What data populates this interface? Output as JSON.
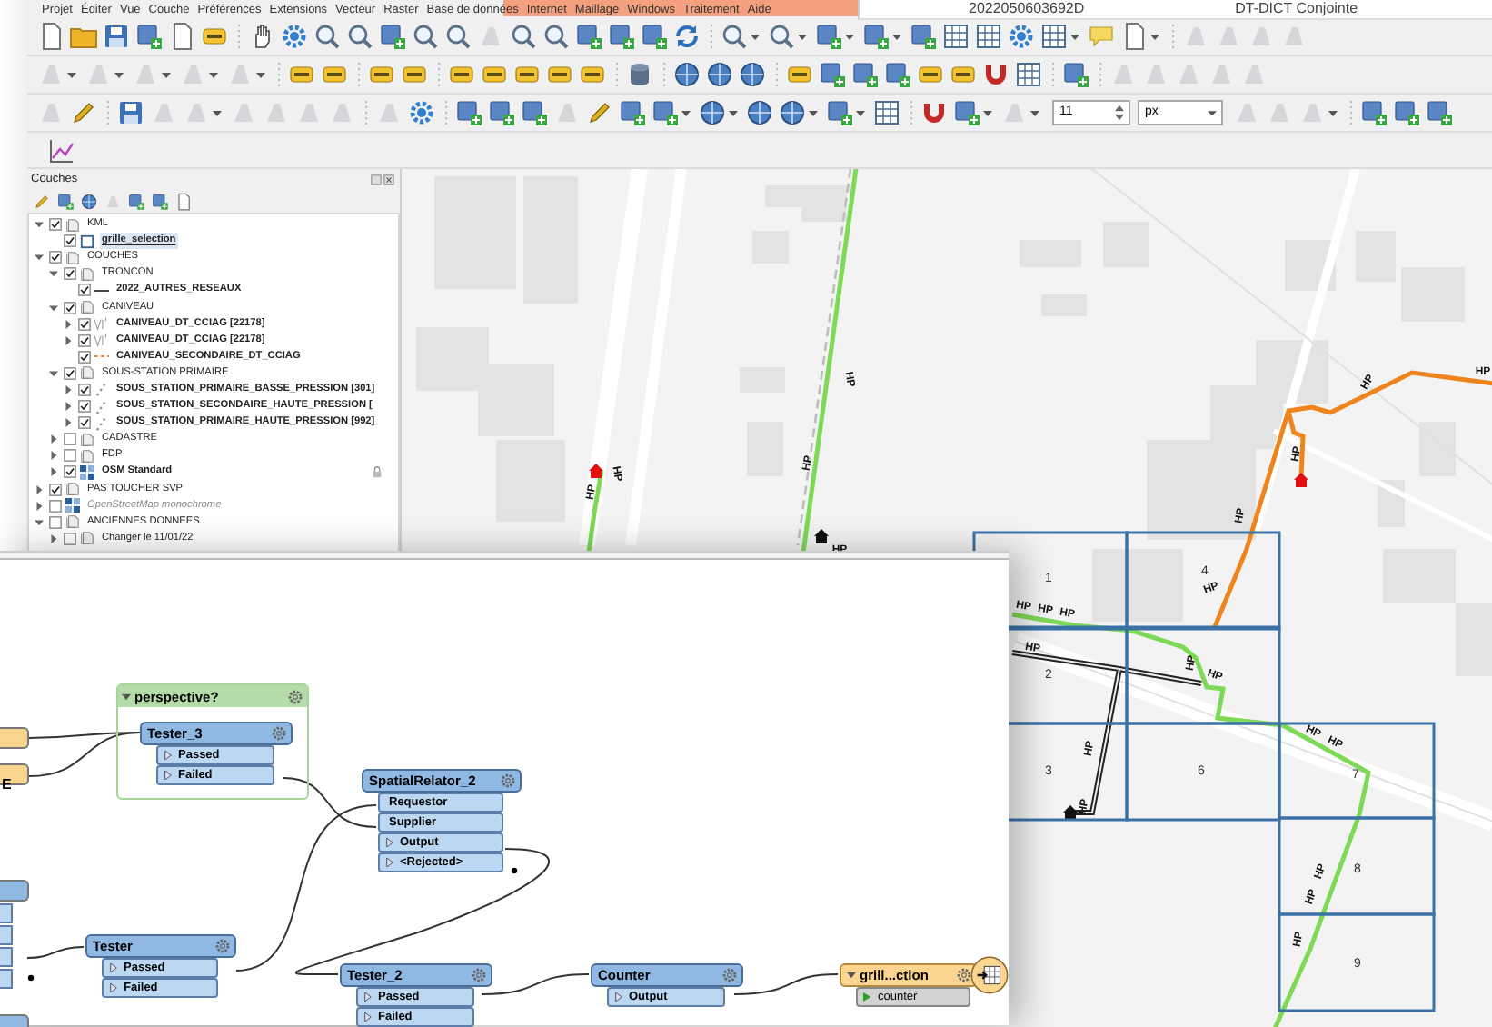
{
  "menu_bar": {
    "items": [
      "Projet",
      "Éditer",
      "Vue",
      "Couche",
      "Préférences",
      "Extensions",
      "Vecteur",
      "Raster",
      "Base de données",
      "Internet",
      "Maillage",
      "Windows",
      "Traitement",
      "Aide"
    ]
  },
  "attribute_table_row": {
    "cells": [
      "2022050603692D",
      "DT-DICT Conjointe"
    ]
  },
  "toolbar": {
    "tolerance": "11",
    "unit": "px"
  },
  "layers_panel": {
    "title": "Couches",
    "tree": [
      {
        "label": "KML",
        "kind": "group",
        "checked": true,
        "selected": false,
        "expanded": true,
        "children": [
          {
            "label": "grille_selection",
            "kind": "polygon",
            "checked": true,
            "selected": true
          }
        ]
      },
      {
        "label": "COUCHES",
        "kind": "group",
        "checked": true,
        "selected": false,
        "expanded": true,
        "children": [
          {
            "label": "TRONCON",
            "kind": "group",
            "checked": true,
            "selected": false,
            "expanded": true,
            "children": [
              {
                "label": "2022_AUTRES_RESEAUX",
                "kind": "line",
                "checked": true,
                "selected": false
              }
            ]
          },
          {
            "label": "CANIVEAU",
            "kind": "group",
            "checked": true,
            "selected": false,
            "expanded": true,
            "children": [
              {
                "label": "CANIVEAU_DT_CCIAG [22178]",
                "kind": "category",
                "checked": true,
                "selected": false,
                "expanded": false
              },
              {
                "label": "CANIVEAU_DT_CCIAG [22178]",
                "kind": "category",
                "checked": true,
                "selected": false,
                "expanded": false
              },
              {
                "label": "CANIVEAU_SECONDAIRE_DT_CCIAG",
                "kind": "dashed",
                "checked": true,
                "selected": false
              }
            ]
          },
          {
            "label": "SOUS-STATION PRIMAIRE",
            "kind": "group",
            "checked": true,
            "selected": false,
            "expanded": true,
            "children": [
              {
                "label": "SOUS_STATION_PRIMAIRE_BASSE_PRESSION [301]",
                "kind": "point",
                "checked": true,
                "selected": false,
                "expanded": false
              },
              {
                "label": "SOUS_STATION_SECONDAIRE_HAUTE_PRESSION [",
                "kind": "point",
                "checked": true,
                "selected": false,
                "expanded": false
              },
              {
                "label": "SOUS_STATION_PRIMAIRE_HAUTE_PRESSION [992]",
                "kind": "point",
                "checked": true,
                "selected": false,
                "expanded": false
              }
            ]
          },
          {
            "label": "CADASTRE",
            "kind": "group",
            "checked": false,
            "selected": false,
            "expanded": false
          },
          {
            "label": "FDP",
            "kind": "group",
            "checked": false,
            "selected": false,
            "expanded": false
          },
          {
            "label": "OSM Standard",
            "kind": "raster",
            "checked": true,
            "selected": false,
            "expanded": false,
            "locked": true
          }
        ]
      },
      {
        "label": "PAS TOUCHER SVP",
        "kind": "group",
        "checked": true,
        "selected": false,
        "expanded": false
      },
      {
        "label": "OpenStreetMap monochrome",
        "kind": "raster",
        "checked": false,
        "selected": false,
        "expanded": false
      },
      {
        "label": "ANCIENNES DONNEES",
        "kind": "group",
        "checked": false,
        "selected": false,
        "expanded": true,
        "children": [
          {
            "label": "Changer le 11/01/22",
            "kind": "group",
            "checked": false,
            "selected": false,
            "expanded": false
          }
        ]
      }
    ]
  },
  "map": {
    "grid_cells": [
      "1",
      "2",
      "3",
      "4",
      "6",
      "7",
      "8",
      "9"
    ],
    "pipe_labels": [
      "HP",
      "HP",
      "HP",
      "HP",
      "HP",
      "HP",
      "HP",
      "HP",
      "HP",
      "HP",
      "HP",
      "HP",
      "HP",
      "HP",
      "HP",
      "HP",
      "HP",
      "HP",
      "HP",
      "HP",
      "HP",
      "HP",
      "HP"
    ]
  },
  "workbench": {
    "cut_off_node": {
      "label": "E"
    },
    "bookmark": {
      "title": "perspective?"
    },
    "transformers": [
      {
        "name": "Tester_3",
        "kind": "transformer",
        "ports": [
          {
            "label": "Passed",
            "kind": "output"
          },
          {
            "label": "Failed",
            "kind": "output"
          }
        ]
      },
      {
        "name": "SpatialRelator_2",
        "kind": "transformer",
        "ports": [
          {
            "label": "Requestor",
            "kind": "input"
          },
          {
            "label": "Supplier",
            "kind": "input"
          },
          {
            "label": "Output",
            "kind": "output"
          },
          {
            "label": "<Rejected>",
            "kind": "output"
          }
        ]
      },
      {
        "name": "Tester",
        "kind": "transformer",
        "ports": [
          {
            "label": "Passed",
            "kind": "output"
          },
          {
            "label": "Failed",
            "kind": "output"
          }
        ]
      },
      {
        "name": "Tester_2",
        "kind": "transformer",
        "ports": [
          {
            "label": "Passed",
            "kind": "output"
          },
          {
            "label": "Failed",
            "kind": "output"
          }
        ]
      },
      {
        "name": "Counter",
        "kind": "transformer",
        "ports": [
          {
            "label": "Output",
            "kind": "output"
          }
        ]
      },
      {
        "name": "grill...ction",
        "kind": "writer",
        "ports": [
          {
            "label": "counter",
            "kind": "attribute"
          }
        ]
      }
    ]
  }
}
